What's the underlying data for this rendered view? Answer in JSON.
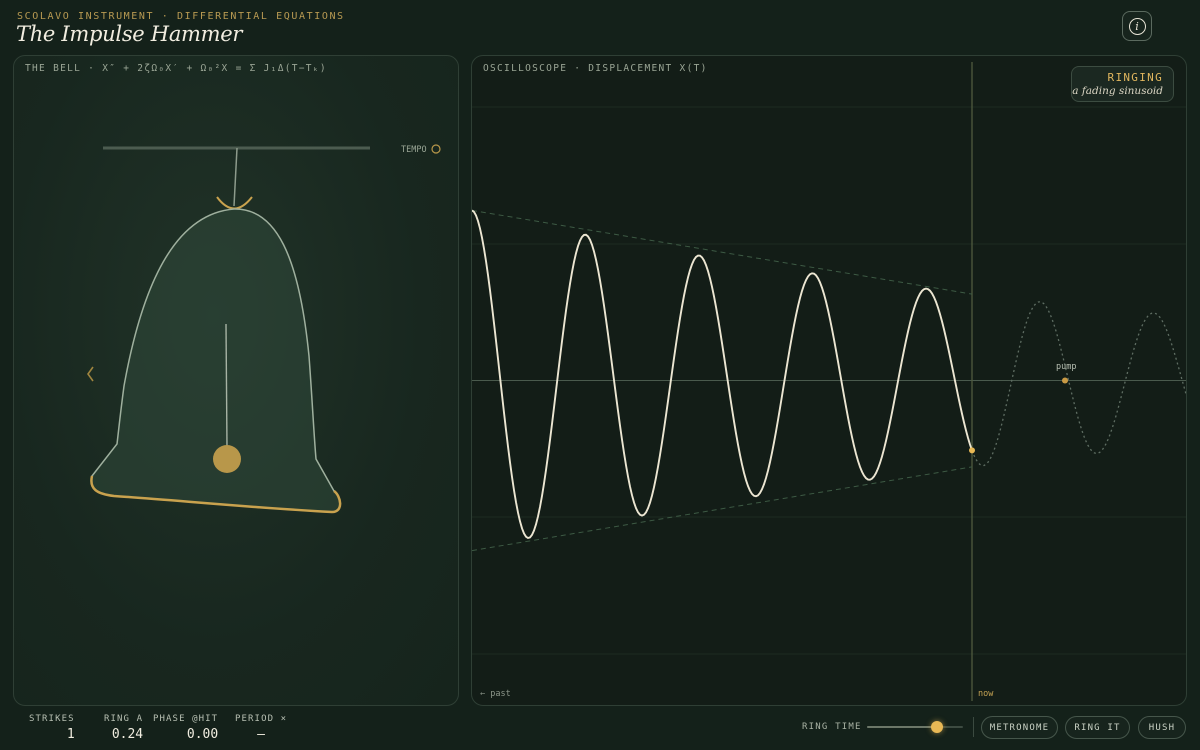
{
  "header": {
    "eyebrow": "SCOLAVO INSTRUMENT · DIFFERENTIAL EQUATIONS",
    "title": "The Impulse Hammer",
    "info_icon": "info-icon"
  },
  "bell_panel": {
    "label": "THE BELL · X″ + 2ζΩ₀X′ + Ω₀²X = Σ J₁Δ(T−Tₖ)",
    "tempo_label": "TEMPO",
    "nav_icon": "chevron-left-icon",
    "colors": {
      "rim": "#c9a24e",
      "clapper": "#b8974a",
      "outline": "#9fb09e"
    }
  },
  "scope_panel": {
    "label": "OSCILLOSCOPE · DISPLACEMENT X(T)",
    "status_title": "RINGING",
    "status_subtitle": "a fading sinusoid",
    "past_label": "← past",
    "now_label": "now",
    "marker_label": "pump",
    "trace": {
      "amplitude_start": 0.63,
      "amplitude_now": 0.32,
      "cycles_visible": 4.4,
      "phase_at_now": 0.2
    },
    "colors": {
      "trace": "#ece6d2",
      "accent": "#e0b65e",
      "envelope": "#3d5a44"
    }
  },
  "stats": [
    {
      "label": "STRIKES",
      "value": "1"
    },
    {
      "label": "RING A",
      "value": "0.24"
    },
    {
      "label": "PHASE @HIT",
      "value": "0.00"
    },
    {
      "label": "PERIOD ×",
      "value": "—"
    }
  ],
  "controls": {
    "ring_time_label": "RING TIME",
    "ring_time_level": 0.73,
    "buttons": [
      "METRONOME",
      "RING IT",
      "HUSH"
    ]
  }
}
